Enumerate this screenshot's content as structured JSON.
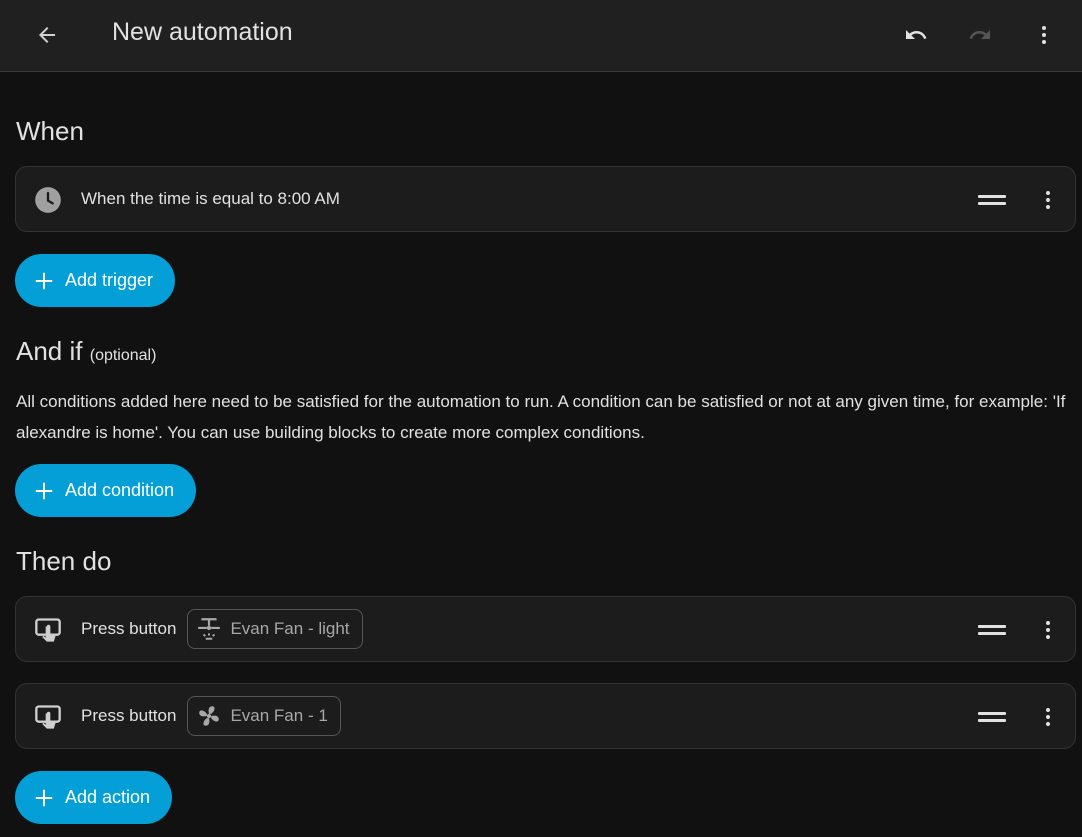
{
  "header": {
    "title": "New automation",
    "icons": {
      "back": "arrow-left-icon",
      "undo": "undo-icon",
      "redo": "redo-icon",
      "menu": "dots-vertical-icon"
    },
    "colors": {
      "background": "#202020",
      "redo_disabled": "#555555"
    }
  },
  "when": {
    "title": "When",
    "triggers": [
      {
        "icon": "clock-icon",
        "text": "When the time is equal to 8:00 AM"
      }
    ],
    "add_label": "Add trigger"
  },
  "and_if": {
    "title": "And if",
    "optional": "(optional)",
    "description": "All conditions added here need to be satisfied for the automation to run. A condition can be satisfied or not at any given time, for example: 'If alexandre is home'. You can use building blocks to create more complex conditions.",
    "add_label": "Add condition"
  },
  "then_do": {
    "title": "Then do",
    "actions": [
      {
        "icon": "gesture-tap-button-icon",
        "text": "Press button",
        "entity": "Evan Fan - light",
        "entity_icon": "ceiling-fan-light-icon"
      },
      {
        "icon": "gesture-tap-button-icon",
        "text": "Press button",
        "entity": "Evan Fan - 1",
        "entity_icon": "fan-icon"
      }
    ],
    "add_label": "Add action"
  },
  "colors": {
    "accent": "#039fd6",
    "page_background": "#111111",
    "card_background": "#1c1c1c",
    "text": "#e1e1e1"
  }
}
